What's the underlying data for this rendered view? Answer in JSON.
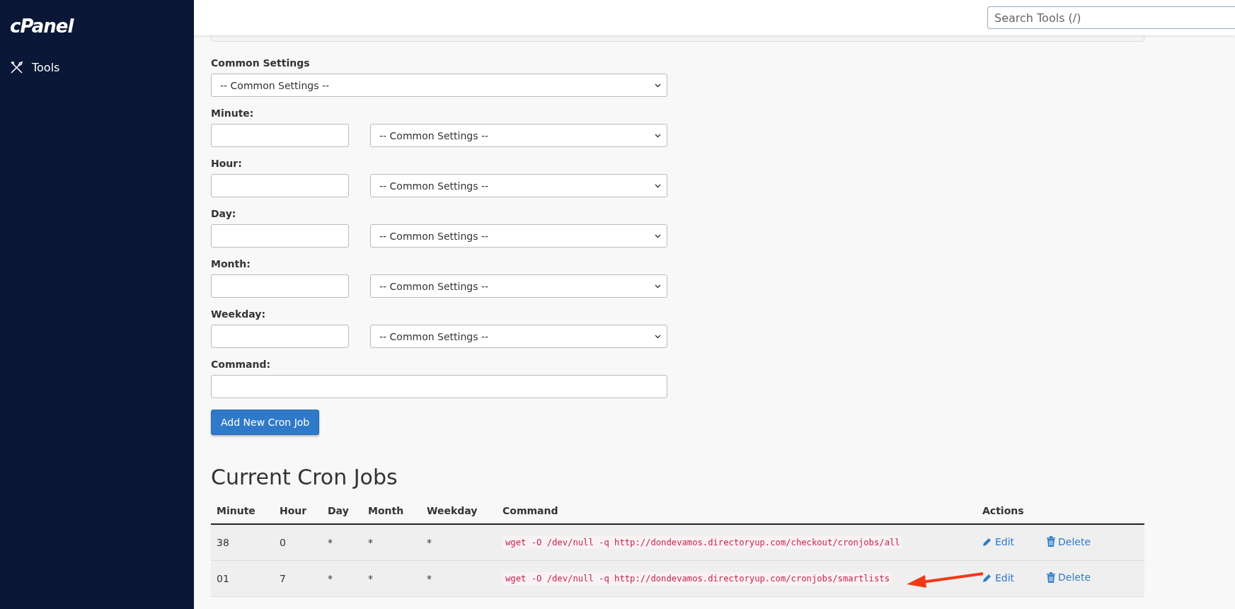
{
  "sidebar": {
    "logo": "cPanel",
    "items": [
      {
        "label": "Tools",
        "selected": false
      }
    ]
  },
  "search": {
    "placeholder": "Search Tools (/)"
  },
  "form": {
    "common": {
      "label": "Common Settings",
      "value": "-- Common Settings --"
    },
    "fields": [
      {
        "label": "Minute:",
        "select": "-- Common Settings --"
      },
      {
        "label": "Hour:",
        "select": "-- Common Settings --"
      },
      {
        "label": "Day:",
        "select": "-- Common Settings --"
      },
      {
        "label": "Month:",
        "select": "-- Common Settings --"
      },
      {
        "label": "Weekday:",
        "select": "-- Common Settings --"
      }
    ],
    "command": {
      "label": "Command:"
    },
    "submit": "Add New Cron Job"
  },
  "cron_jobs": {
    "title": "Current Cron Jobs",
    "columns": [
      "Minute",
      "Hour",
      "Day",
      "Month",
      "Weekday",
      "Command",
      "Actions"
    ],
    "rows": [
      {
        "minute": "38",
        "hour": "0",
        "day": "*",
        "month": "*",
        "weekday": "*",
        "command": "wget -O /dev/null -q http://dondevamos.directoryup.com/checkout/cronjobs/all",
        "edit": "Edit",
        "delete": "Delete",
        "annotated": false
      },
      {
        "minute": "01",
        "hour": "7",
        "day": "*",
        "month": "*",
        "weekday": "*",
        "command": "wget -O /dev/null -q http://dondevamos.directoryup.com/cronjobs/smartlists",
        "edit": "Edit",
        "delete": "Delete",
        "annotated": true
      }
    ]
  }
}
